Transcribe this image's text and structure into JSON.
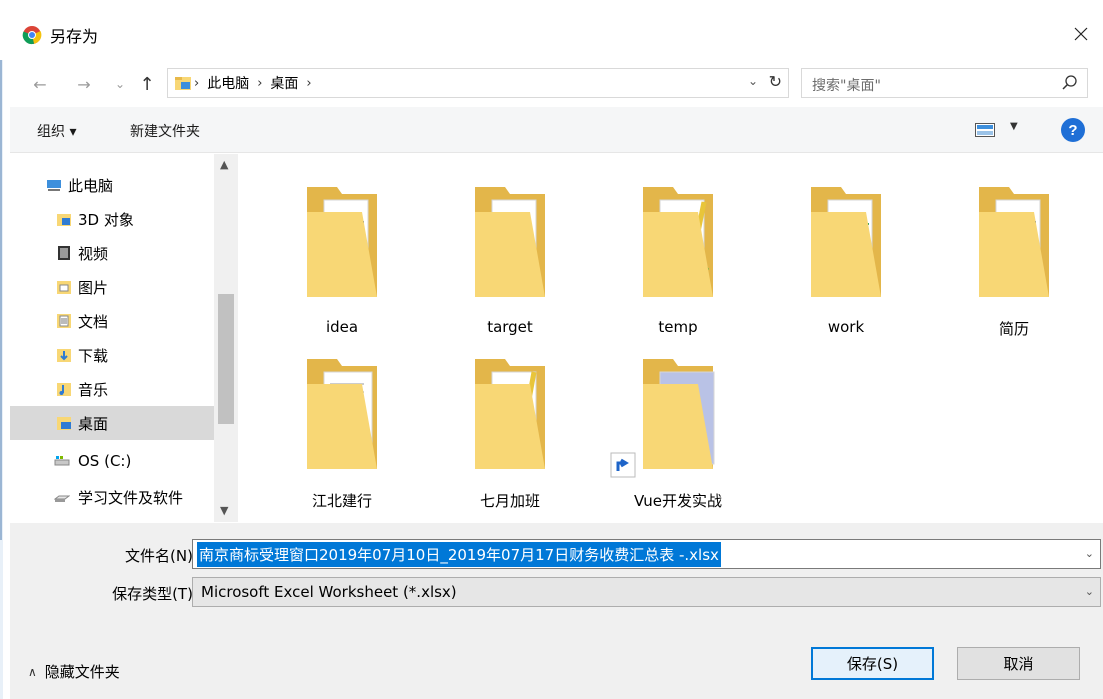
{
  "window": {
    "title": "另存为",
    "close_symbol": "✕"
  },
  "nav": {
    "back": "←",
    "forward": "→",
    "recent": "⌄",
    "up": "↑"
  },
  "address": {
    "root_sep": "›",
    "crumbs": [
      "此电脑",
      "桌面"
    ],
    "sep": "›",
    "dropdown": "⌄",
    "refresh": "↻"
  },
  "search": {
    "placeholder": "搜索\"桌面\""
  },
  "toolbar": {
    "organize": "组织 ▾",
    "new_folder": "新建文件夹",
    "view_dropdown": "▼",
    "help": "?"
  },
  "sidebar": {
    "scroll_up": "▲",
    "scroll_down": "▼",
    "items": [
      {
        "label": "此电脑",
        "icon": "computer-icon"
      },
      {
        "label": "3D 对象",
        "icon": "3d-objects-icon"
      },
      {
        "label": "视频",
        "icon": "video-icon"
      },
      {
        "label": "图片",
        "icon": "pictures-icon"
      },
      {
        "label": "文档",
        "icon": "documents-icon"
      },
      {
        "label": "下载",
        "icon": "downloads-icon"
      },
      {
        "label": "音乐",
        "icon": "music-icon"
      },
      {
        "label": "桌面",
        "icon": "desktop-icon",
        "selected": true
      },
      {
        "label": "OS (C:)",
        "icon": "drive-icon"
      },
      {
        "label": "学习文件及软件",
        "icon": "drive-icon"
      }
    ]
  },
  "folders": [
    {
      "label": "idea",
      "icon": "folder-word-icon"
    },
    {
      "label": "target",
      "icon": "folder-blank-icon"
    },
    {
      "label": "temp",
      "icon": "folder-word-pencil-icon"
    },
    {
      "label": "work",
      "icon": "folder-markdown-icon"
    },
    {
      "label": "简历",
      "icon": "folder-word-icon"
    },
    {
      "label": "江北建行",
      "icon": "folder-document-icon"
    },
    {
      "label": "七月加班",
      "icon": "folder-image-icon"
    },
    {
      "label": "Vue开发实战",
      "icon": "folder-shortcut-video-icon"
    }
  ],
  "form": {
    "filename_label": "文件名(N):",
    "filename_value": "南京商标受理窗口2019年07月10日_2019年07月17日财务收费汇总表 -.xlsx",
    "filetype_label": "保存类型(T):",
    "filetype_value": "Microsoft Excel Worksheet (*.xlsx)",
    "dropdown": "⌄"
  },
  "footer": {
    "hide_chevron": "∧",
    "hide_folders": "隐藏文件夹",
    "save": "保存(S)",
    "cancel": "取消"
  },
  "colors": {
    "accent": "#0078d7",
    "folder": "#f8d775",
    "help": "#1f6fd6"
  }
}
